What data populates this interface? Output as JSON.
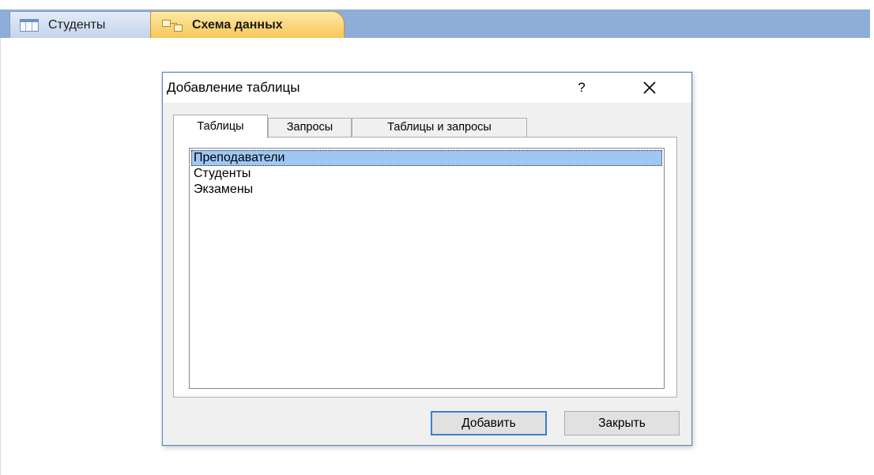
{
  "document_tabs": [
    {
      "label": "Студенты",
      "icon": "table-icon",
      "active": false
    },
    {
      "label": "Схема данных",
      "icon": "relationships-icon",
      "active": true
    }
  ],
  "colors": {
    "tab_strip": "#8fadd9",
    "active_tab": "#f7c758",
    "selection": "#9fc7f5",
    "default_button_border": "#3c7fd4"
  },
  "dialog": {
    "title": "Добавление таблицы",
    "help_label": "?",
    "close_icon": "close-icon",
    "tabs": [
      {
        "label": "Таблицы",
        "active": true
      },
      {
        "label": "Запросы",
        "active": false
      },
      {
        "label": "Таблицы и запросы",
        "active": false
      }
    ],
    "list_items": [
      {
        "label": "Преподаватели",
        "selected": true
      },
      {
        "label": "Студенты",
        "selected": false
      },
      {
        "label": "Экзамены",
        "selected": false
      }
    ],
    "buttons": {
      "add_label": "Добавить",
      "close_label": "Закрыть"
    }
  }
}
